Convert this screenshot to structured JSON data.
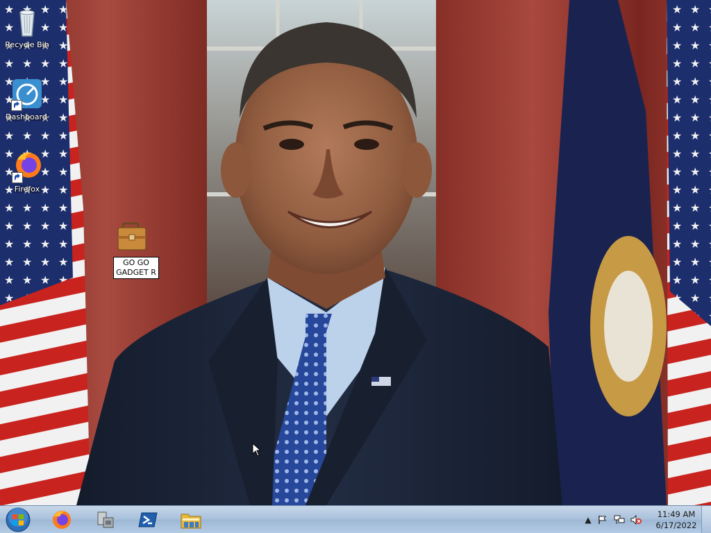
{
  "desktop": {
    "icons": [
      {
        "label": "Recycle Bin"
      },
      {
        "label": "Dashboard"
      },
      {
        "label": "Firefox"
      }
    ],
    "rename_item": {
      "value": "GO GO GADGET R"
    }
  },
  "taskbar": {
    "start_icon": "windows-orb",
    "pinned": [
      "firefox-icon",
      "device-manager-icon",
      "powershell-icon",
      "file-explorer-icon"
    ],
    "tray": {
      "icons": [
        "show-hidden-icons",
        "action-center-flag",
        "network-icon",
        "volume-muted-icon"
      ],
      "time": "11:49 AM",
      "date": "6/17/2022"
    }
  },
  "colors": {
    "taskbar": "#a9c1dc",
    "curtain": "#8c2f28",
    "suit": "#1b2538",
    "shirt": "#bcd1ea",
    "tie": "#2a4a9a"
  }
}
